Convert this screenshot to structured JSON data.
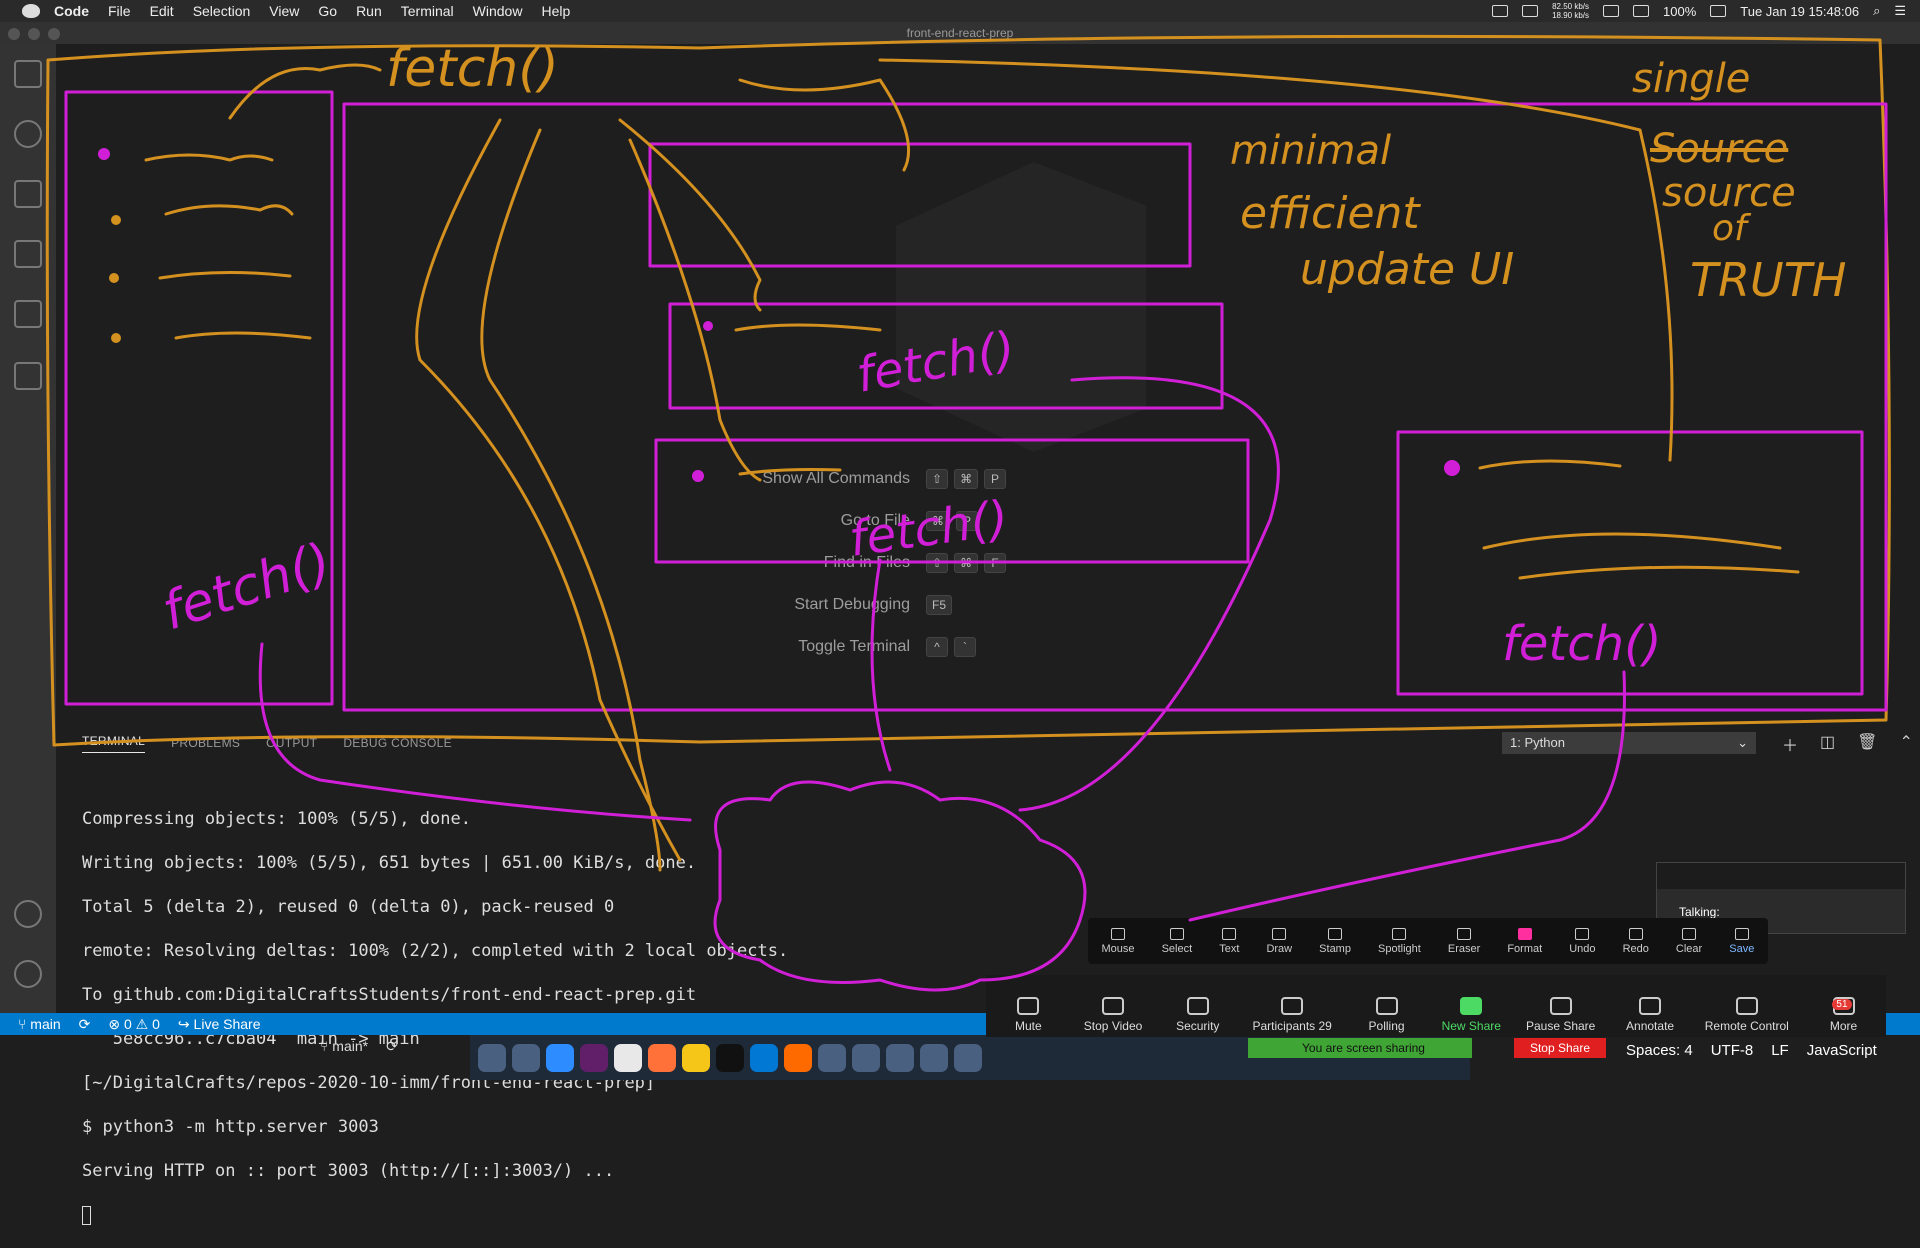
{
  "menubar": {
    "app": "Code",
    "items": [
      "File",
      "Edit",
      "Selection",
      "View",
      "Go",
      "Run",
      "Terminal",
      "Window",
      "Help"
    ],
    "net_up": "82.50 kb/s",
    "net_down": "18.90 kb/s",
    "battery": "100%",
    "datetime": "Tue Jan 19  15:48:06"
  },
  "window": {
    "title": "front-end-react-prep"
  },
  "commands": [
    {
      "label": "Show All Commands",
      "keys": [
        "⇧",
        "⌘",
        "P"
      ]
    },
    {
      "label": "Go to File",
      "keys": [
        "⌘",
        "P"
      ]
    },
    {
      "label": "Find in Files",
      "keys": [
        "⇧",
        "⌘",
        "F"
      ]
    },
    {
      "label": "Start Debugging",
      "keys": [
        "F5"
      ]
    },
    {
      "label": "Toggle Terminal",
      "keys": [
        "^",
        "`"
      ]
    }
  ],
  "panel": {
    "tabs": [
      "TERMINAL",
      "PROBLEMS",
      "OUTPUT",
      "DEBUG CONSOLE"
    ],
    "select": "1: Python"
  },
  "terminal": {
    "lines": [
      "Compressing objects: 100% (5/5), done.",
      "Writing objects: 100% (5/5), 651 bytes | 651.00 KiB/s, done.",
      "Total 5 (delta 2), reused 0 (delta 0), pack-reused 0",
      "remote: Resolving deltas: 100% (2/2), completed with 2 local objects.",
      "To github.com:DigitalCraftsStudents/front-end-react-prep.git",
      "   5e8cc96..c7cba04  main -> main",
      "[~/DigitalCrafts/repos-2020-10-imm/front-end-react-prep]",
      "$ python3 -m http.server 3003",
      "Serving HTTP on :: port 3003 (http://[::]:3003/) ..."
    ]
  },
  "statusbar": {
    "branch": "main",
    "problems": "⊗ 0 ⚠ 0",
    "liveshare": "Live Share",
    "branch2": "main*",
    "spaces": "Spaces: 4",
    "encoding": "UTF-8",
    "eol": "LF",
    "language": "JavaScript"
  },
  "zoom": {
    "talking": "Talking:",
    "annotate_tools": [
      "Mouse",
      "Select",
      "Text",
      "Draw",
      "Stamp",
      "Spotlight",
      "Eraser",
      "Format",
      "Undo",
      "Redo",
      "Clear",
      "Save"
    ],
    "controls": [
      {
        "label": "Mute"
      },
      {
        "label": "Stop Video"
      },
      {
        "label": "Security"
      },
      {
        "label": "Participants",
        "count": "29"
      },
      {
        "label": "Polling"
      },
      {
        "label": "New Share"
      },
      {
        "label": "Pause Share"
      },
      {
        "label": "Annotate"
      },
      {
        "label": "Remote Control"
      },
      {
        "label": "More",
        "badge": "51"
      }
    ],
    "sharing_banner": "You are screen sharing",
    "stop_share": "Stop Share"
  },
  "drawing": {
    "texts": [
      "fetch()",
      "minimal",
      "efficient",
      "update UI",
      "single",
      "Source",
      "source",
      "of",
      "TRUTH",
      "fetch()",
      "fetch()",
      "fetch()",
      "fetch()"
    ],
    "colors": {
      "orange": "#d4911f",
      "magenta": "#d11fd8"
    }
  }
}
